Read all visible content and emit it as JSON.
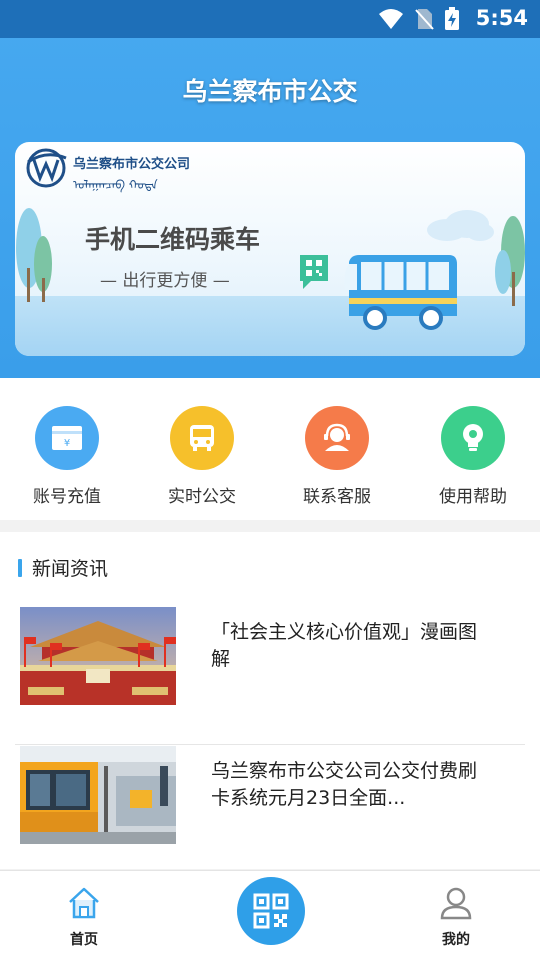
{
  "status_bar": {
    "time": "5:54",
    "icons": [
      "wifi-icon",
      "no-sim-icon",
      "battery-charging-icon"
    ]
  },
  "header": {
    "title": "乌兰察布市公交"
  },
  "banner": {
    "company_name": "乌兰察布市公交公司",
    "headline": "手机二维码乘车",
    "subline": "— 出行更方便 —"
  },
  "quick_actions": [
    {
      "label": "账号充值",
      "icon": "card-recharge-icon",
      "color": "#4aaaf2"
    },
    {
      "label": "实时公交",
      "icon": "bus-icon",
      "color": "#f6c02b"
    },
    {
      "label": "联系客服",
      "icon": "customer-service-icon",
      "color": "#f57b4a"
    },
    {
      "label": "使用帮助",
      "icon": "lightbulb-icon",
      "color": "#3ccf8c"
    }
  ],
  "news": {
    "section_title": "新闻资讯",
    "items": [
      {
        "title": "「社会主义核心价值观」漫画图解",
        "image": "tiananmen-gate-photo"
      },
      {
        "title": "乌兰察布市公交公司公交付费刷卡系统元月23日全面...",
        "image": "bus-station-photo"
      }
    ]
  },
  "tabbar": {
    "home_label": "首页",
    "mine_label": "我的",
    "scan_icon": "qr-code-icon"
  },
  "colors": {
    "primary": "#3a9eea",
    "status_bar": "#1e6fb8",
    "accent_bar": "#3aa5ec"
  }
}
